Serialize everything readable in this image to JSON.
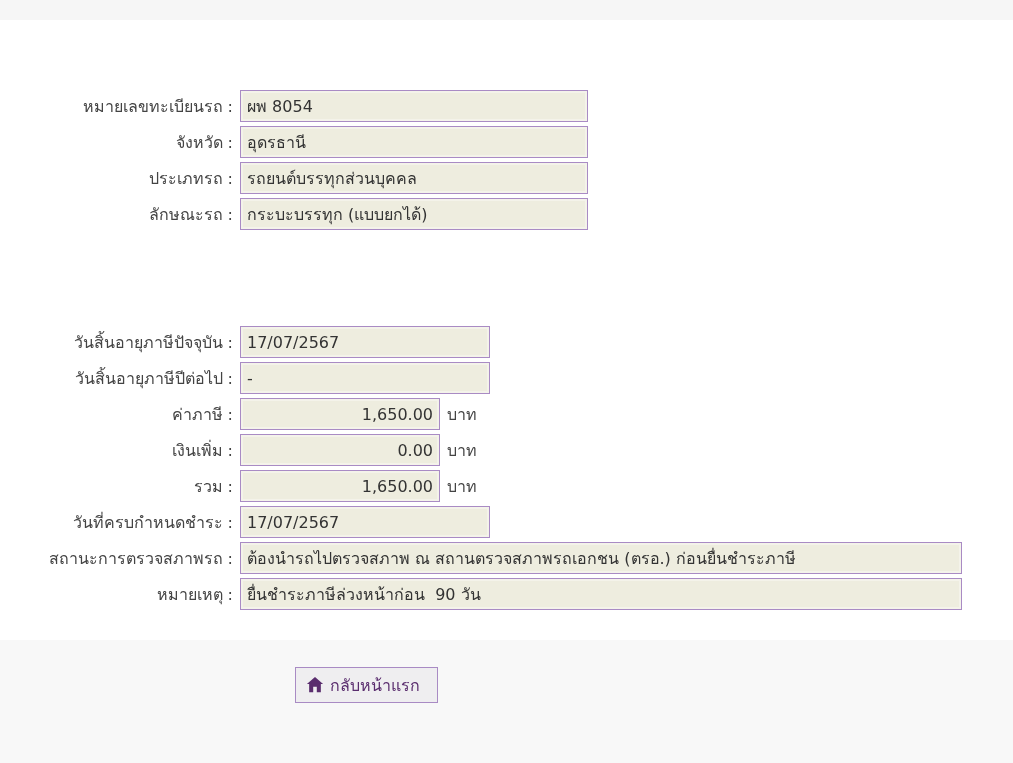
{
  "vehicle": [
    {
      "label": "หมายเลขทะเบียนรถ :",
      "value": "ผพ 8054",
      "kind": "long"
    },
    {
      "label": "จังหวัด :",
      "value": "อุดรธานี",
      "kind": "long"
    },
    {
      "label": "ประเภทรถ :",
      "value": "รถยนต์บรรทุกส่วนบุคคล",
      "kind": "long"
    },
    {
      "label": "ลักษณะรถ :",
      "value": "กระบะบรรทุก (แบบยกได้)",
      "kind": "long"
    }
  ],
  "tax": [
    {
      "label": "วันสิ้นอายุภาษีปัจจุบัน :",
      "value": "17/07/2567",
      "kind": "medium"
    },
    {
      "label": "วันสิ้นอายุภาษีปีต่อไป :",
      "value": "-",
      "kind": "medium"
    },
    {
      "label": "ค่าภาษี :",
      "value": "1,650.00",
      "kind": "amount",
      "unit": "บาท"
    },
    {
      "label": "เงินเพิ่ม :",
      "value": "0.00",
      "kind": "amount",
      "unit": "บาท"
    },
    {
      "label": "รวม :",
      "value": "1,650.00",
      "kind": "amount",
      "unit": "บาท"
    },
    {
      "label": "วันที่ครบกำหนดชำระ :",
      "value": "17/07/2567",
      "kind": "medium"
    },
    {
      "label": "สถานะการตรวจสภาพรถ :",
      "value": "ต้องนำรถไปตรวจสภาพ ณ สถานตรวจสภาพรถเอกชน (ตรอ.) ก่อนยื่นชำระภาษี",
      "kind": "full"
    },
    {
      "label": "หมายเหตุ :",
      "value": "ยื่นชำระภาษีล่วงหน้าก่อน  90 วัน",
      "kind": "full"
    }
  ],
  "home_button": {
    "label": "กลับหน้าแรก"
  }
}
